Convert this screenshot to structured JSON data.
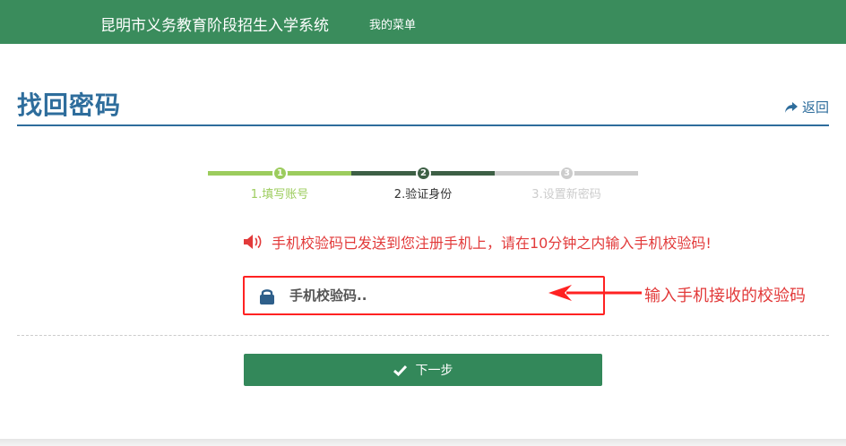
{
  "header": {
    "app_title": "昆明市义务教育阶段招生入学系统",
    "menu_label": "我的菜单"
  },
  "page": {
    "title": "找回密码",
    "back_label": "返回"
  },
  "steps": [
    {
      "number": "1",
      "label": "1.填写账号",
      "state": "done",
      "color": "#9ccc5d"
    },
    {
      "number": "2",
      "label": "2.验证身份",
      "state": "current",
      "color": "#3d5f45"
    },
    {
      "number": "3",
      "label": "3.设置新密码",
      "state": "pending",
      "color": "#cccccc"
    }
  ],
  "notice": {
    "text": "手机校验码已发送到您注册手机上，请在10分钟之内输入手机校验码!",
    "icon": "speaker-icon"
  },
  "code_input": {
    "placeholder": "手机校验码..",
    "value": "",
    "icon": "lock-icon"
  },
  "annotation": {
    "text": "输入手机接收的校验码"
  },
  "next_button": {
    "label": "下一步",
    "icon": "check-icon"
  },
  "colors": {
    "header_bg": "#3a8c5c",
    "title": "#2e6d9c",
    "alert": "#e23a3a",
    "button": "#33885a"
  }
}
